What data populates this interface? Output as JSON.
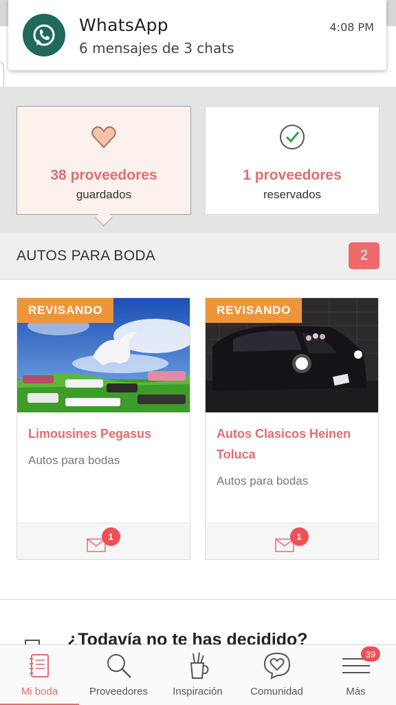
{
  "notification": {
    "app": "WhatsApp",
    "message": "6 mensajes de 3 chats",
    "time": "4:08 PM"
  },
  "summary": {
    "saved": {
      "count": "38 proveedores",
      "label": "guardados"
    },
    "booked": {
      "count": "1 proveedores",
      "label": "reservados"
    }
  },
  "section": {
    "title": "AUTOS PARA BODA",
    "count": "2"
  },
  "vendors": [
    {
      "status": "REVISANDO",
      "name": "Limousines Pegasus",
      "category": "Autos para bodas",
      "messages": "1"
    },
    {
      "status": "REVISANDO",
      "name": "Autos Clasicos Heinen Toluca",
      "category": "Autos para bodas",
      "messages": "1"
    }
  ],
  "promo": {
    "text": "¿Todavía no te has decidido?"
  },
  "nav": {
    "items": [
      {
        "label": "Mi boda",
        "icon": "notebook-icon"
      },
      {
        "label": "Proveedores",
        "icon": "search-icon"
      },
      {
        "label": "Inspiración",
        "icon": "pencil-cup-icon"
      },
      {
        "label": "Comunidad",
        "icon": "heart-chat-icon"
      },
      {
        "label": "Más",
        "icon": "menu-icon",
        "badge": "39"
      }
    ]
  },
  "colors": {
    "accent": "#e36d6d",
    "status": "#ef9539",
    "badge": "#ef4f57",
    "whatsapp": "#1f6a5b"
  }
}
